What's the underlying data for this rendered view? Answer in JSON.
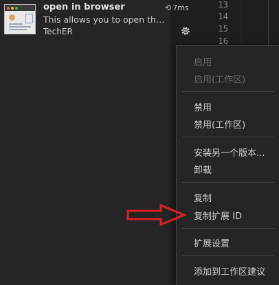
{
  "extension": {
    "name": "open in browser",
    "install_time": "7ms",
    "description": "This allows you to open the current file in your default browser or application.",
    "publisher": "TechER"
  },
  "editor": {
    "line_numbers": [
      "13",
      "14",
      "15",
      "16"
    ]
  },
  "context_menu": {
    "items": [
      {
        "label": "启用",
        "enabled": false
      },
      {
        "label": "启用(工作区)",
        "enabled": false
      },
      {
        "label": "禁用",
        "enabled": true
      },
      {
        "label": "禁用(工作区)",
        "enabled": true
      },
      {
        "label": "安装另一个版本...",
        "enabled": true
      },
      {
        "label": "卸载",
        "enabled": true
      },
      {
        "label": "复制",
        "enabled": true
      },
      {
        "label": "复制扩展 ID",
        "enabled": true
      },
      {
        "label": "扩展设置",
        "enabled": true
      },
      {
        "label": "添加到工作区建议",
        "enabled": true
      }
    ]
  },
  "colors": {
    "sidebar_bg": "#252526",
    "editor_bg": "#1e1e1e",
    "menu_border": "#454545",
    "annotation_arrow": "#e02020"
  }
}
